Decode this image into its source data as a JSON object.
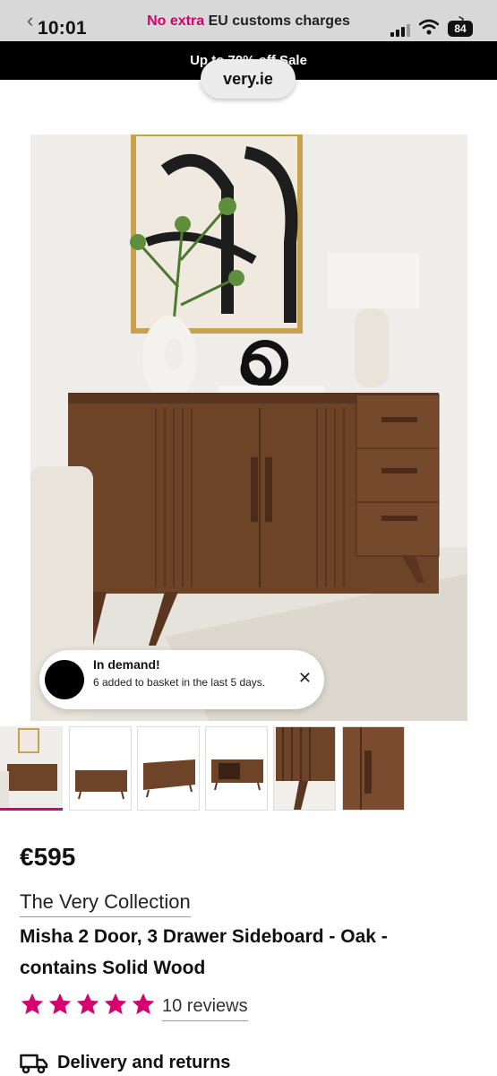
{
  "status_bar": {
    "time": "10:01",
    "battery": "84",
    "promo_accent": "No extra",
    "promo_rest": " EU customs charges"
  },
  "sale_banner": {
    "text": "Up to 70% off Sale"
  },
  "browser": {
    "url": "very.ie"
  },
  "toast": {
    "title": "In demand!",
    "text": "6 added to basket in the last 5 days.",
    "close_icon": "close-icon"
  },
  "gallery": {
    "thumbnails": [
      "lifestyle",
      "front",
      "angle",
      "open",
      "side-detail",
      "handle-detail"
    ],
    "selected_index": 0
  },
  "product": {
    "price": "€595",
    "brand": "The Very Collection",
    "title": "Misha 2 Door, 3 Drawer Sideboard - Oak - contains Solid Wood",
    "rating": 5,
    "rating_max": 5,
    "reviews": "10 reviews",
    "delivery_label": "Delivery and returns",
    "delivery_icon": "truck-icon"
  },
  "colors": {
    "accent": "#d6006e",
    "banner_bg": "#000000",
    "status_bg": "#d8d8d8",
    "wood": "#6e4429"
  }
}
